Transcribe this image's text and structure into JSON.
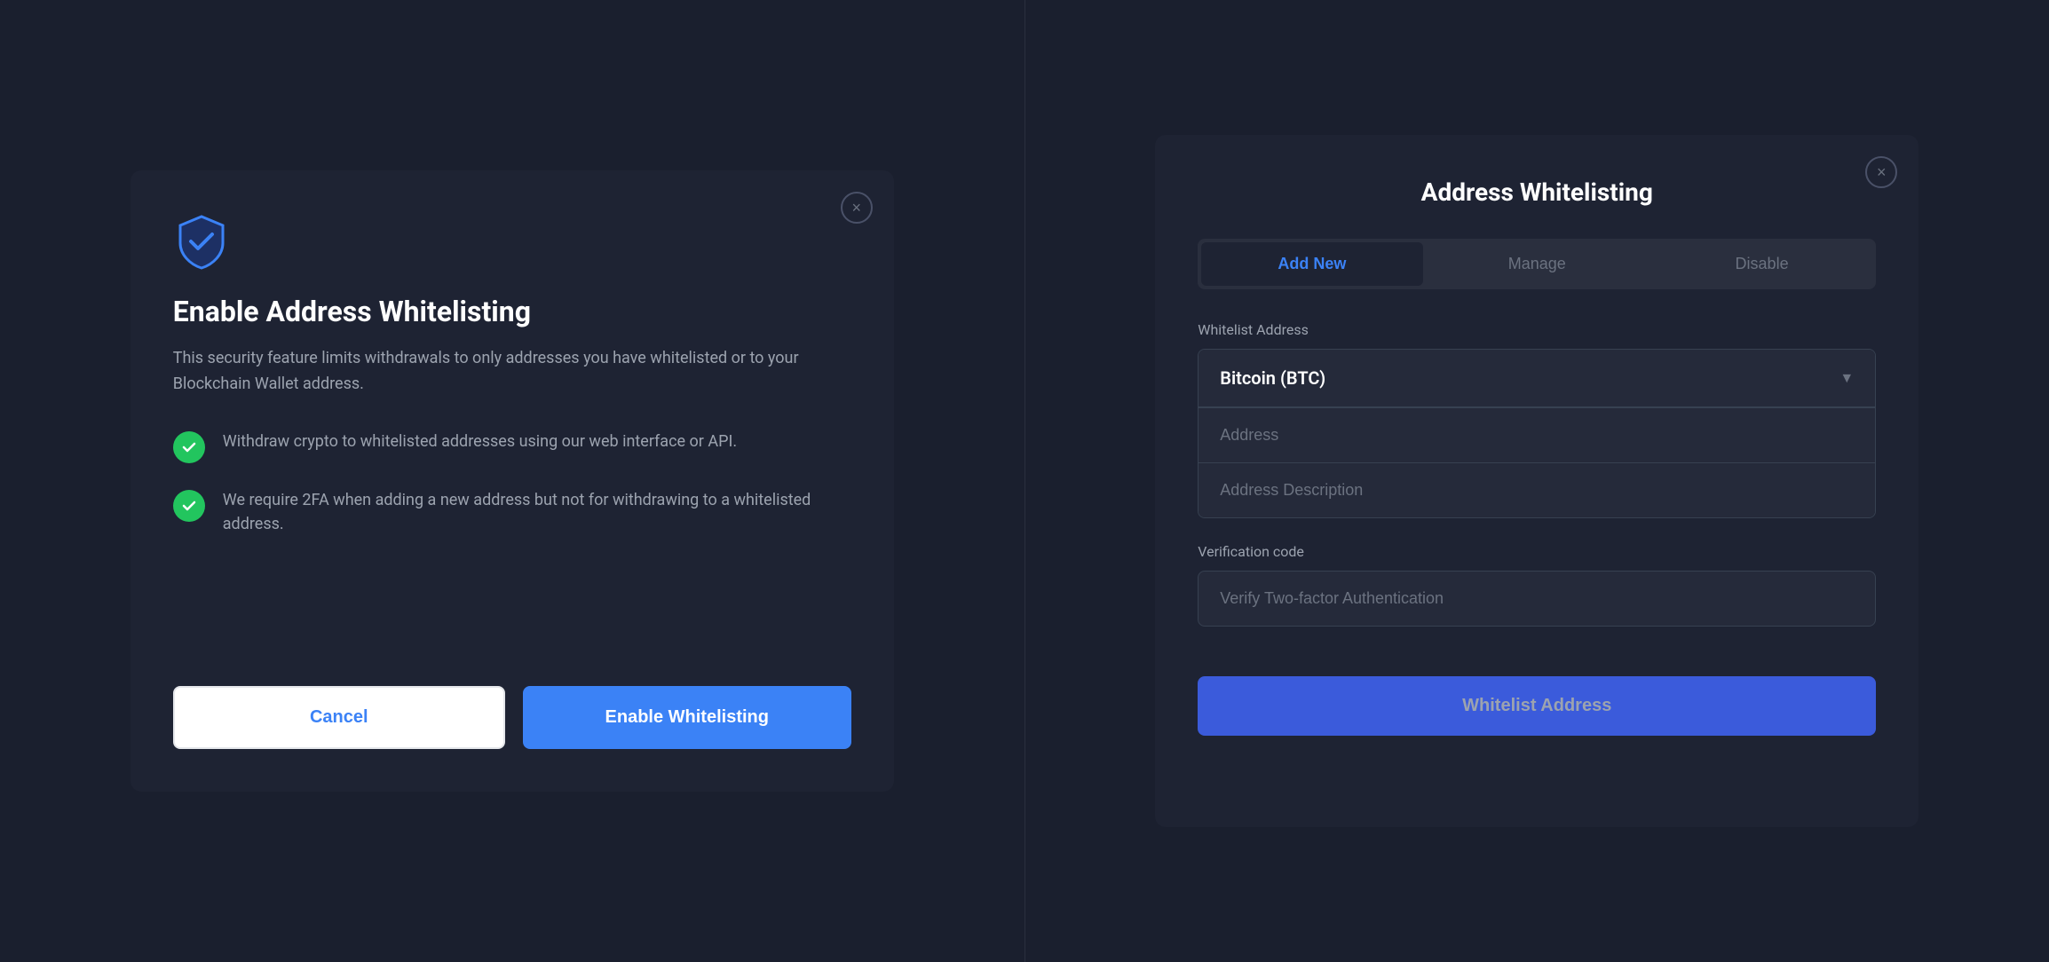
{
  "left_modal": {
    "close_label": "×",
    "title": "Enable Address Whitelisting",
    "description": "This security feature limits withdrawals to only addresses you have whitelisted or to your Blockchain Wallet address.",
    "features": [
      {
        "text": "Withdraw crypto to whitelisted addresses using our web interface or API."
      },
      {
        "text": "We require 2FA when adding a new address but not for withdrawing to a whitelisted address."
      }
    ],
    "cancel_label": "Cancel",
    "enable_label": "Enable Whitelisting"
  },
  "right_modal": {
    "close_label": "×",
    "title": "Address Whitelisting",
    "tabs": [
      {
        "label": "Add New",
        "active": true
      },
      {
        "label": "Manage",
        "active": false
      },
      {
        "label": "Disable",
        "active": false
      }
    ],
    "whitelist_address_label": "Whitelist Address",
    "currency_selected": "Bitcoin (BTC)",
    "address_placeholder": "Address",
    "address_description_placeholder": "Address Description",
    "verification_label": "Verification code",
    "verification_placeholder": "Verify Two-factor Authentication",
    "submit_label": "Whitelist Address"
  }
}
